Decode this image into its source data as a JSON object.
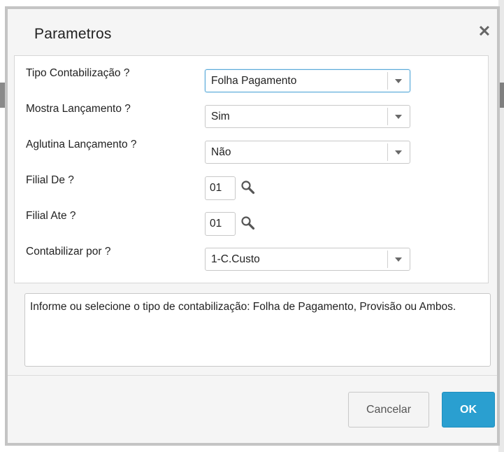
{
  "dialog": {
    "title": "Parametros",
    "close_icon": "close-icon"
  },
  "form": {
    "fields": [
      {
        "label": "Tipo Contabilização ?",
        "type": "select",
        "value": "Folha Pagamento",
        "focused": true
      },
      {
        "label": "Mostra Lançamento ?",
        "type": "select",
        "value": "Sim"
      },
      {
        "label": "Aglutina Lançamento ?",
        "type": "select",
        "value": "Não"
      },
      {
        "label": "Filial De ?",
        "type": "lookup",
        "value": "01",
        "icon": "search-icon"
      },
      {
        "label": "Filial Ate ?",
        "type": "lookup",
        "value": "01",
        "icon": "search-icon"
      },
      {
        "label": "Contabilizar por ?",
        "type": "select",
        "value": "1-C.Custo"
      }
    ]
  },
  "help": {
    "text": "Informe ou selecione o tipo de contabilização: Folha de Pagamento, Provisão ou Ambos."
  },
  "buttons": {
    "cancel": "Cancelar",
    "ok": "OK"
  },
  "colors": {
    "primary": "#2a9fd0",
    "focus_border": "#57a9d8",
    "dialog_bg": "#f5f5f5"
  }
}
